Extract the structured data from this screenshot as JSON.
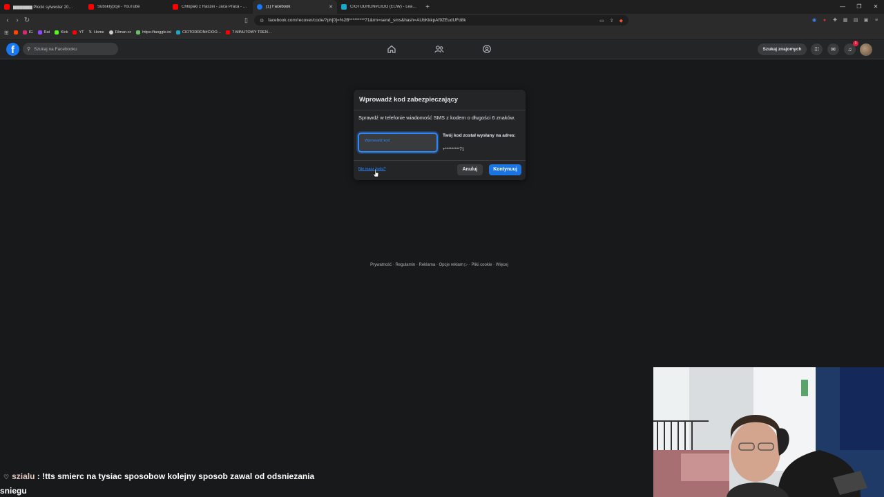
{
  "browser": {
    "tabs": [
      {
        "title": "▆▆▆▆▆▆ Płocki sylwester 20…",
        "favicon_color": "#ff0000"
      },
      {
        "title": "Subskrypcje - YouTube",
        "favicon_color": "#ff0000"
      },
      {
        "title": "Chłopaki z Raszei - Jaca Praca - YouT",
        "favicon_color": "#ff0000"
      },
      {
        "title": "(1) Facebook",
        "favicon_color": "#1877f2",
        "active": true
      },
      {
        "title": "CIOTODRON#CIOO (EUW) - League",
        "favicon_color": "#1aa8c8"
      }
    ],
    "new_tab": "+",
    "address": "facebook.com/recover/code/?ph[0]=%2B*********71&rm=send_sms&hash=AUbKkkpAf9ZEudUFd8k",
    "bookmarks": [
      {
        "label": "",
        "color": "#ff4500"
      },
      {
        "label": "IG",
        "color": "#d62976"
      },
      {
        "label": "Rat",
        "color": "#9146ff"
      },
      {
        "label": "Kick",
        "color": "#53fc18"
      },
      {
        "label": "YT",
        "color": "#ff0000"
      },
      {
        "label": "Home",
        "color": "#ffffff"
      },
      {
        "label": "Filman.cc",
        "color": "#cccccc"
      },
      {
        "label": "https://tanggle.io/",
        "color": "#6abf69"
      },
      {
        "label": "CIOTODRON#CIOO…",
        "color": "#1aa8c8"
      },
      {
        "label": "7-MINUTOWY TREN…",
        "color": "#ff0000"
      }
    ]
  },
  "facebook": {
    "logo": "f",
    "search_placeholder": "Szukaj na Facebooku",
    "find_friends": "Szukaj znajomych",
    "notification_count": "1",
    "dialog": {
      "title": "Wprowadź kod zabezpieczający",
      "instructions": "Sprawdź w telefonie wiadomość SMS z kodem o długości 6 znaków.",
      "input_placeholder": "Wprowadź kod",
      "sent_to_label": "Twój kod został wysłany na adres:",
      "phone": "+*********71",
      "no_code_link": "Nie masz kodu?",
      "cancel": "Anuluj",
      "continue": "Kontynuuj"
    },
    "footer": "Prywatność · Regulamin · Reklama · Opcje reklam ▷ · Pliki cookie · Więcej"
  },
  "chat": {
    "username": "szialu",
    "message": ": !tts smierc na tysiac sposobow kolejny sposob zawal od odsniezania sniegu"
  }
}
